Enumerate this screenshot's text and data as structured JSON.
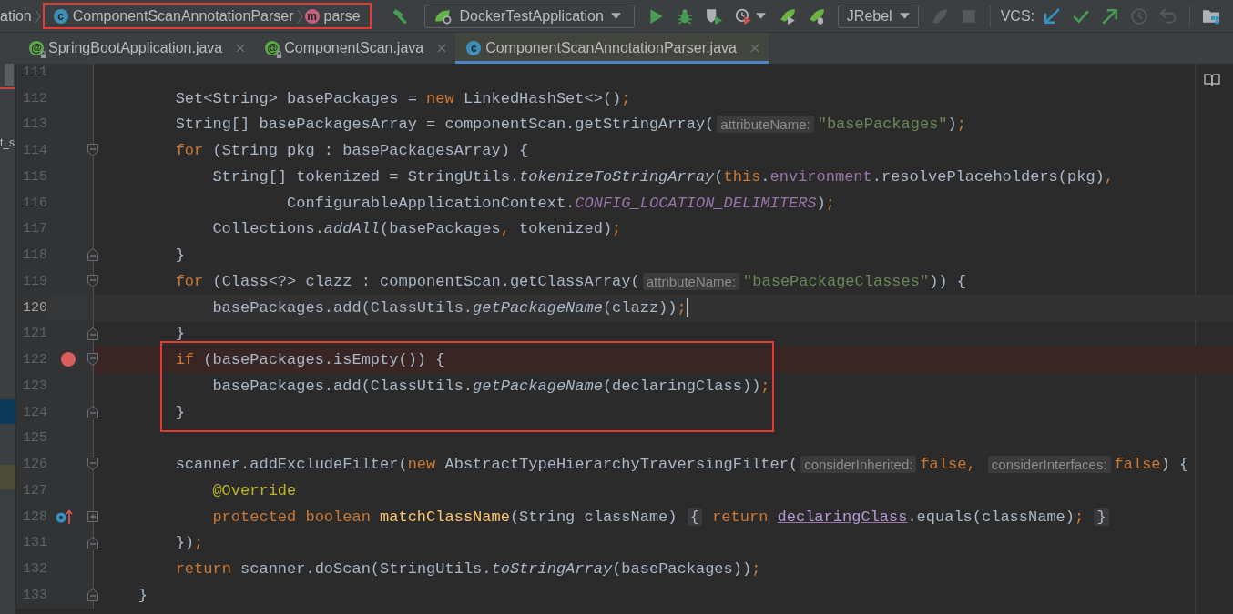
{
  "toolbar": {
    "breadcrumbs": [
      {
        "label": "ation",
        "highlighted": false
      },
      {
        "label": "ComponentScanAnnotationParser",
        "kind": "class",
        "badge": "c",
        "highlighted": true
      },
      {
        "label": "parse",
        "kind": "method",
        "badge": "m",
        "highlighted": true
      }
    ],
    "actions": [
      {
        "kind": "build",
        "disabled": false
      },
      {
        "kind": "run-config",
        "label": "DockerTestApplication"
      },
      {
        "kind": "run",
        "disabled": false
      },
      {
        "kind": "debug",
        "disabled": false
      },
      {
        "kind": "coverage",
        "disabled": false
      },
      {
        "kind": "profile",
        "disabled": false
      },
      {
        "kind": "jrebel-run",
        "disabled": false
      },
      {
        "kind": "jrebel-debug",
        "disabled": false
      },
      {
        "kind": "dropdown",
        "label": "JRebel"
      },
      {
        "kind": "attach",
        "disabled": true
      },
      {
        "kind": "stop",
        "disabled": true
      },
      {
        "kind": "separator"
      },
      {
        "kind": "label",
        "label": "VCS:"
      },
      {
        "kind": "vcs-update",
        "disabled": false
      },
      {
        "kind": "vcs-commit",
        "disabled": false
      },
      {
        "kind": "vcs-push",
        "disabled": false
      },
      {
        "kind": "vcs-history",
        "disabled": true
      },
      {
        "kind": "vcs-rollback",
        "disabled": true
      },
      {
        "kind": "separator"
      },
      {
        "kind": "project-structure",
        "disabled": false
      }
    ]
  },
  "tabs": [
    {
      "label": "SpringBootApplication.java",
      "kind": "annotation",
      "badge": "@",
      "locked": true,
      "selected": false
    },
    {
      "label": "ComponentScan.java",
      "kind": "annotation",
      "badge": "@",
      "locked": true,
      "selected": false
    },
    {
      "label": "ComponentScanAnnotationParser.java",
      "kind": "class",
      "badge": "c",
      "locked": false,
      "selected": true
    }
  ],
  "project_panel": {
    "label": "t_s",
    "rows": [
      {
        "selected": true
      },
      {
        "selected": false
      }
    ]
  },
  "editor": {
    "lines": [
      {
        "number": "111",
        "kind": "plain",
        "current": false,
        "breakpoint": false,
        "overrides": false,
        "boxed": false
      },
      {
        "number": "112",
        "kind": "plain",
        "tokens": [
          {
            "text": "        Set<String> basePackages = ",
            "kind": "plain"
          },
          {
            "text": "new",
            "kind": "keyword"
          },
          {
            "text": " LinkedHashSet<>()",
            "kind": "plain"
          },
          {
            "text": ";",
            "kind": "punct"
          }
        ],
        "current": false,
        "breakpoint": false,
        "overrides": false,
        "boxed": false
      },
      {
        "number": "113",
        "kind": "plain",
        "tokens": [
          {
            "text": "        String[] basePackagesArray = componentScan.getStringArray(",
            "kind": "plain"
          },
          {
            "text": "attributeName:",
            "kind": "hint"
          },
          {
            "text": "\"basePackages\"",
            "kind": "string"
          },
          {
            "text": ")",
            "kind": "plain"
          },
          {
            "text": ";",
            "kind": "punct"
          }
        ],
        "current": false,
        "breakpoint": false,
        "overrides": false,
        "boxed": false
      },
      {
        "number": "114",
        "kind": "block-start",
        "tokens": [
          {
            "text": "        for",
            "kind": "keyword"
          },
          {
            "text": " (String pkg : basePackagesArray) {",
            "kind": "plain"
          }
        ],
        "current": false,
        "breakpoint": false,
        "overrides": false,
        "boxed": false
      },
      {
        "number": "115",
        "kind": "plain",
        "tokens": [
          {
            "text": "            String[] tokenized = StringUtils.",
            "kind": "plain"
          },
          {
            "text": "tokenizeToStringArray",
            "kind": "static-call"
          },
          {
            "text": "(",
            "kind": "plain"
          },
          {
            "text": "this",
            "kind": "keyword"
          },
          {
            "text": ".",
            "kind": "plain"
          },
          {
            "text": "environment",
            "kind": "field"
          },
          {
            "text": ".resolvePlaceholders(pkg)",
            "kind": "plain"
          },
          {
            "text": ",",
            "kind": "punct"
          }
        ],
        "current": false,
        "breakpoint": false,
        "overrides": false,
        "boxed": false
      },
      {
        "number": "116",
        "kind": "plain",
        "tokens": [
          {
            "text": "                    ConfigurableApplicationContext.",
            "kind": "plain"
          },
          {
            "text": "CONFIG_LOCATION_DELIMITERS",
            "kind": "static-field"
          },
          {
            "text": ")",
            "kind": "plain"
          },
          {
            "text": ";",
            "kind": "punct"
          }
        ],
        "current": false,
        "breakpoint": false,
        "overrides": false,
        "boxed": false
      },
      {
        "number": "117",
        "kind": "plain",
        "tokens": [
          {
            "text": "            Collections.",
            "kind": "plain"
          },
          {
            "text": "addAll",
            "kind": "static-call"
          },
          {
            "text": "(basePackages",
            "kind": "plain"
          },
          {
            "text": ",",
            "kind": "punct"
          },
          {
            "text": " tokenized)",
            "kind": "plain"
          },
          {
            "text": ";",
            "kind": "punct"
          }
        ],
        "current": false,
        "breakpoint": false,
        "overrides": false,
        "boxed": false
      },
      {
        "number": "118",
        "kind": "block-end",
        "tokens": [
          {
            "text": "        }",
            "kind": "plain"
          }
        ],
        "current": false,
        "breakpoint": false,
        "overrides": false,
        "boxed": false
      },
      {
        "number": "119",
        "kind": "block-start",
        "tokens": [
          {
            "text": "        for",
            "kind": "keyword"
          },
          {
            "text": " (Class<?> clazz : componentScan.getClassArray(",
            "kind": "plain"
          },
          {
            "text": "attributeName:",
            "kind": "hint"
          },
          {
            "text": "\"basePackageClasses\"",
            "kind": "string"
          },
          {
            "text": ")) {",
            "kind": "plain"
          }
        ],
        "current": false,
        "breakpoint": false,
        "overrides": false,
        "boxed": false
      },
      {
        "number": "120",
        "kind": "plain",
        "tokens": [
          {
            "text": "            basePackages.add(ClassUtils.",
            "kind": "plain"
          },
          {
            "text": "getPackageName",
            "kind": "static-call"
          },
          {
            "text": "(clazz))",
            "kind": "plain"
          },
          {
            "text": ";",
            "kind": "punct"
          }
        ],
        "current": true,
        "breakpoint": false,
        "overrides": false,
        "boxed": false
      },
      {
        "number": "121",
        "kind": "block-end",
        "tokens": [
          {
            "text": "        }",
            "kind": "plain"
          }
        ],
        "current": false,
        "breakpoint": false,
        "overrides": false,
        "boxed": false
      },
      {
        "number": "122",
        "kind": "block-start",
        "tokens": [
          {
            "text": "        if",
            "kind": "keyword"
          },
          {
            "text": " (basePackages.isEmpty()) {",
            "kind": "plain"
          }
        ],
        "current": false,
        "breakpoint": true,
        "overrides": false,
        "boxed": true
      },
      {
        "number": "123",
        "kind": "plain",
        "tokens": [
          {
            "text": "            basePackages.add(ClassUtils.",
            "kind": "plain"
          },
          {
            "text": "getPackageName",
            "kind": "static-call"
          },
          {
            "text": "(declaringClass))",
            "kind": "plain"
          },
          {
            "text": ";",
            "kind": "punct"
          }
        ],
        "current": false,
        "breakpoint": false,
        "overrides": false,
        "boxed": true
      },
      {
        "number": "124",
        "kind": "block-end",
        "tokens": [
          {
            "text": "        }",
            "kind": "plain"
          }
        ],
        "current": false,
        "breakpoint": false,
        "overrides": false,
        "boxed": true
      },
      {
        "number": "125",
        "kind": "plain",
        "current": false,
        "breakpoint": false,
        "overrides": false,
        "boxed": false
      },
      {
        "number": "126",
        "kind": "block-start",
        "tokens": [
          {
            "text": "        scanner.addExcludeFilter(",
            "kind": "plain"
          },
          {
            "text": "new",
            "kind": "keyword"
          },
          {
            "text": " AbstractTypeHierarchyTraversingFilter(",
            "kind": "plain"
          },
          {
            "text": "considerInherited:",
            "kind": "hint"
          },
          {
            "text": "false",
            "kind": "keyword"
          },
          {
            "text": ", ",
            "kind": "punct"
          },
          {
            "text": "considerInterfaces:",
            "kind": "hint"
          },
          {
            "text": "false",
            "kind": "keyword"
          },
          {
            "text": ") {",
            "kind": "plain"
          }
        ],
        "current": false,
        "breakpoint": false,
        "overrides": false,
        "boxed": false
      },
      {
        "number": "127",
        "kind": "plain",
        "tokens": [
          {
            "text": "            @Override",
            "kind": "annotation"
          }
        ],
        "current": false,
        "breakpoint": false,
        "overrides": false,
        "boxed": false
      },
      {
        "number": "128",
        "kind": "folded",
        "tokens": [
          {
            "text": "            protected boolean ",
            "kind": "keyword"
          },
          {
            "text": "matchClassName",
            "kind": "method-decl"
          },
          {
            "text": "(String className) ",
            "kind": "plain"
          },
          {
            "text": "{",
            "kind": "fold"
          },
          {
            "text": " return ",
            "kind": "keyword"
          },
          {
            "text": "declaringClass",
            "kind": "captured"
          },
          {
            "text": ".equals(className)",
            "kind": "plain"
          },
          {
            "text": "; ",
            "kind": "punct"
          },
          {
            "text": "}",
            "kind": "fold"
          }
        ],
        "current": false,
        "breakpoint": false,
        "overrides": true,
        "boxed": false
      },
      {
        "number": "131",
        "kind": "block-end",
        "tokens": [
          {
            "text": "        })",
            "kind": "plain"
          },
          {
            "text": ";",
            "kind": "punct"
          }
        ],
        "current": false,
        "breakpoint": false,
        "overrides": false,
        "boxed": false
      },
      {
        "number": "132",
        "kind": "plain",
        "tokens": [
          {
            "text": "        return",
            "kind": "keyword"
          },
          {
            "text": " scanner.doScan(StringUtils.",
            "kind": "plain"
          },
          {
            "text": "toStringArray",
            "kind": "static-call"
          },
          {
            "text": "(basePackages))",
            "kind": "plain"
          },
          {
            "text": ";",
            "kind": "punct"
          }
        ],
        "current": false,
        "breakpoint": false,
        "overrides": false,
        "boxed": false
      },
      {
        "number": "133",
        "kind": "block-end",
        "tokens": [
          {
            "text": "    }",
            "kind": "plain"
          }
        ],
        "current": false,
        "breakpoint": false,
        "overrides": false,
        "boxed": false
      }
    ]
  }
}
